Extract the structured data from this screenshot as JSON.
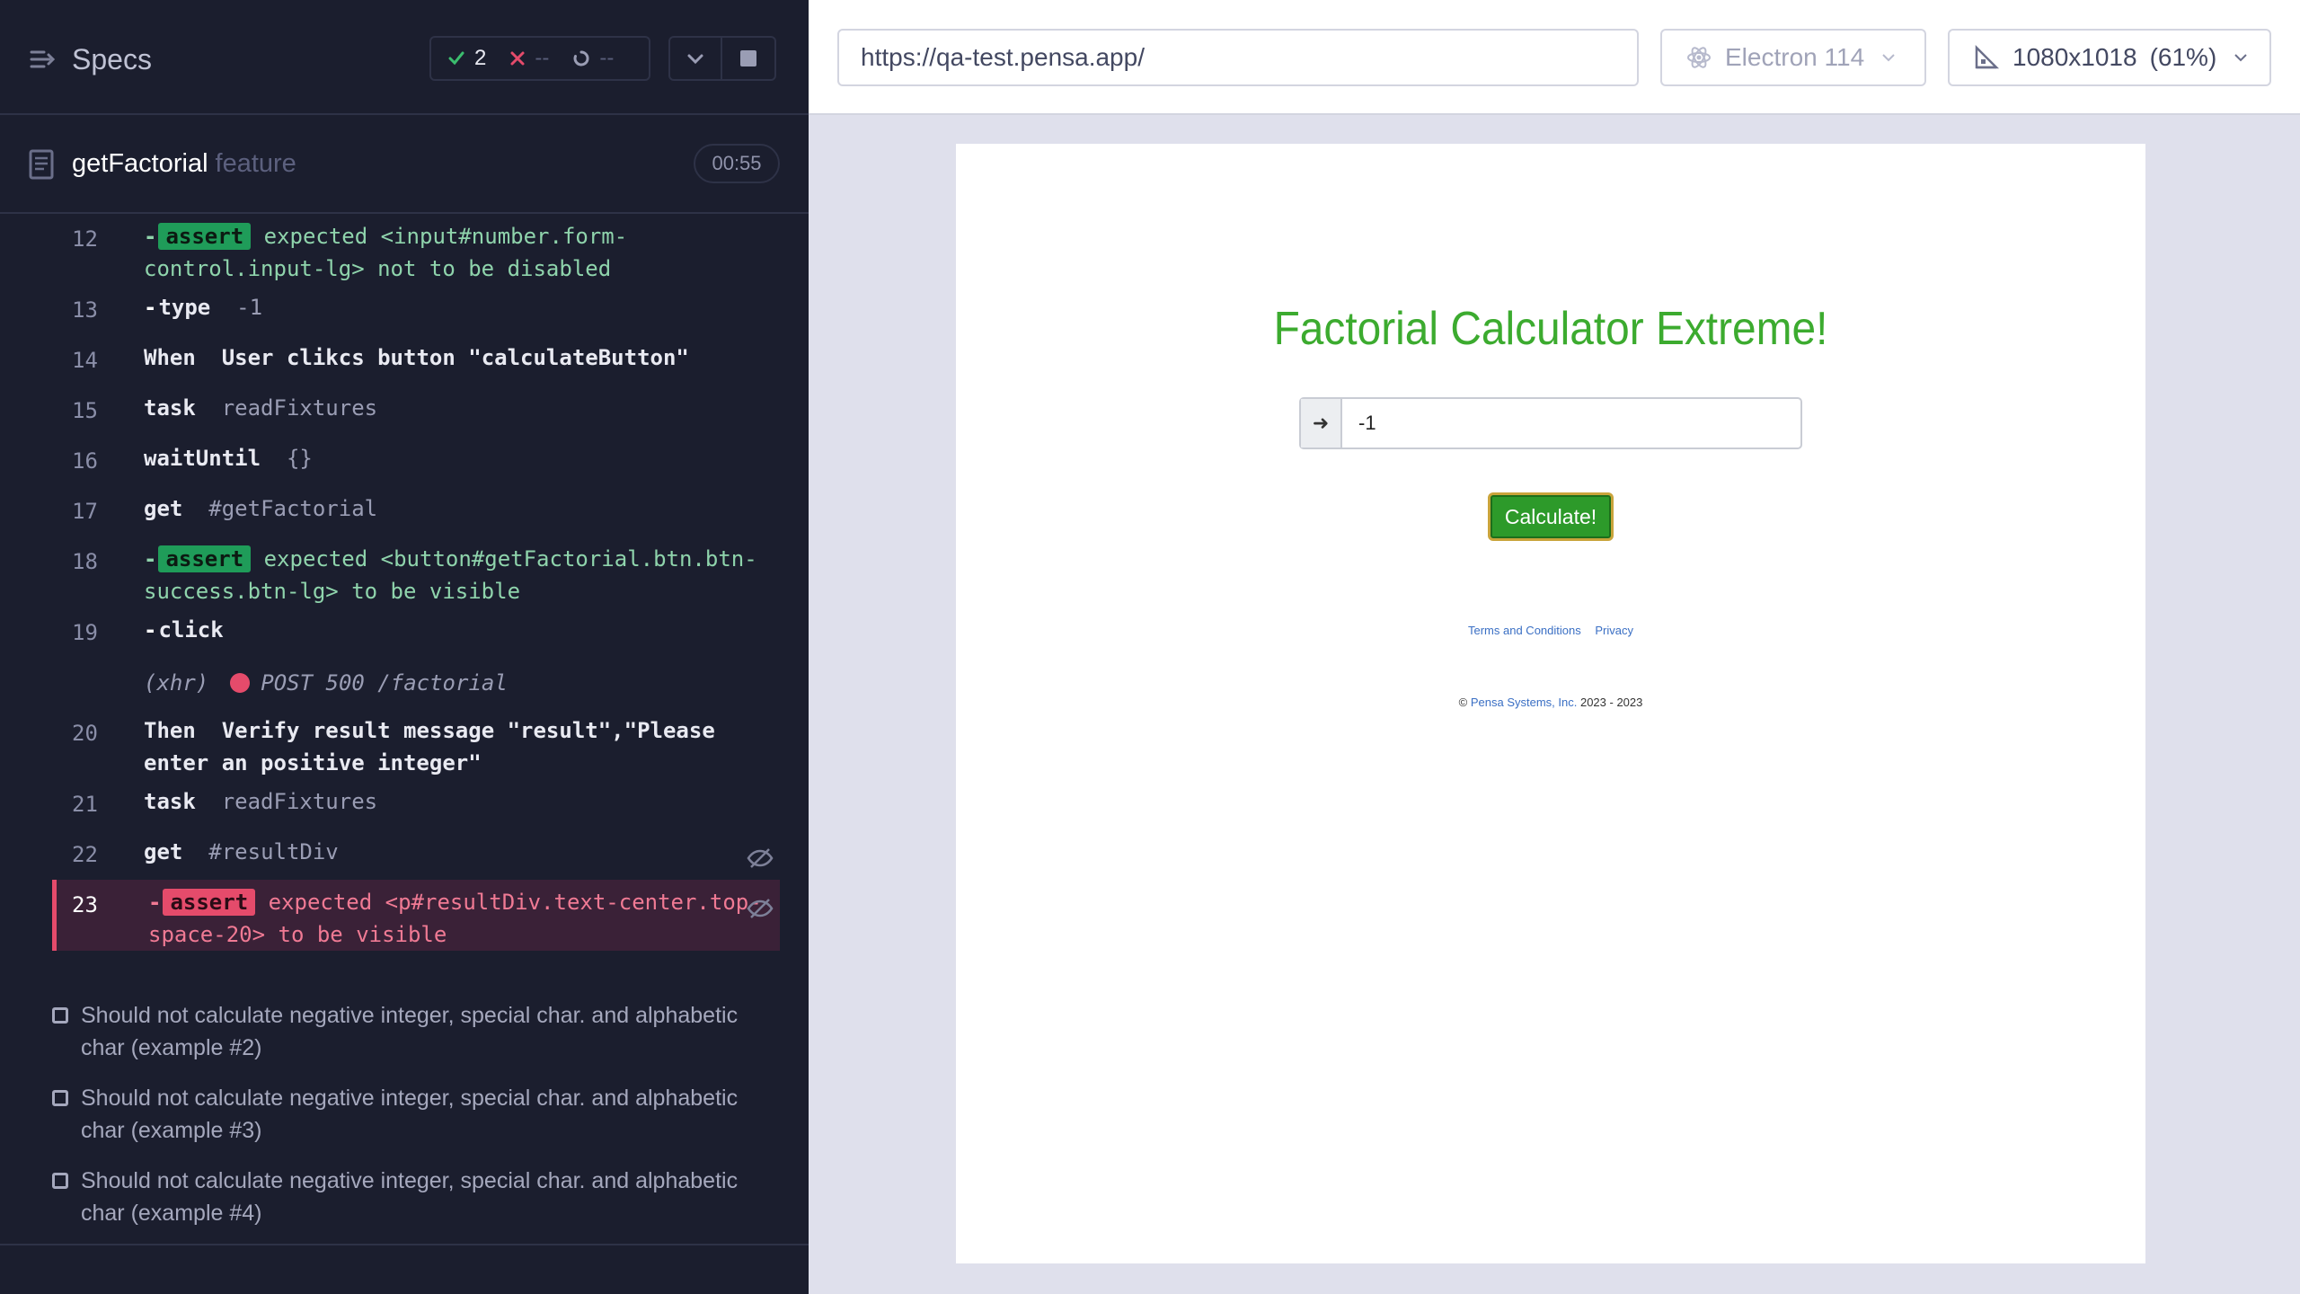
{
  "runner": {
    "specs_label": "Specs",
    "stats": {
      "passed": "2",
      "failed": "--",
      "pending": "--"
    },
    "spec": {
      "name": "getFactorial",
      "extension": "feature",
      "duration": "00:55"
    },
    "commands": [
      {
        "line": "12",
        "type": "assert",
        "badge": "assert",
        "text": "expected <input#number.form-control.input-lg> not to be disabled"
      },
      {
        "line": "13",
        "cmd": "type",
        "arg": "-1"
      },
      {
        "line": "14",
        "cmd": "When",
        "arg": "User clikcs button \"calculateButton\""
      },
      {
        "line": "15",
        "cmd": "task",
        "arg": "readFixtures"
      },
      {
        "line": "16",
        "cmd": "waitUntil",
        "arg": "{}"
      },
      {
        "line": "17",
        "cmd": "get",
        "arg": "#getFactorial"
      },
      {
        "line": "18",
        "type": "assert",
        "badge": "assert",
        "text": "expected <button#getFactorial.btn.btn-success.btn-lg> to be visible"
      },
      {
        "line": "19",
        "cmd": "click",
        "arg": ""
      },
      {
        "line": "",
        "xhr": "(xhr)",
        "xhr_text": "POST 500 /factorial"
      },
      {
        "line": "20",
        "cmd": "Then",
        "arg": "Verify result message \"result\",\"Please enter an positive integer\""
      },
      {
        "line": "21",
        "cmd": "task",
        "arg": "readFixtures"
      },
      {
        "line": "22",
        "cmd": "get",
        "arg": "#resultDiv"
      },
      {
        "line": "23",
        "type": "assert-fail",
        "badge": "assert",
        "text": "expected <p#resultDiv.text-center.top-space-20> to be visible"
      }
    ],
    "tests": [
      "Should not calculate negative integer, special char. and alphabetic char (example #2)",
      "Should not calculate negative integer, special char. and alphabetic char (example #3)",
      "Should not calculate negative integer, special char. and alphabetic char (example #4)"
    ]
  },
  "browser": {
    "url": "https://qa-test.pensa.app/",
    "browser_name": "Electron 114",
    "viewport": "1080x1018",
    "zoom": "(61%)"
  },
  "app": {
    "title": "Factorial Calculator Extreme!",
    "input_value": "-1",
    "button_label": "Calculate!",
    "terms_link": "Terms and Conditions",
    "privacy_link": "Privacy",
    "copyright_prefix": "©",
    "company_link": "Pensa Systems, Inc.",
    "copyright_years": "2023 - 2023"
  },
  "colors": {
    "pass": "#1f9c59",
    "fail": "#e54b6b",
    "app_title": "#3cab2f",
    "button": "#2d9a2a"
  }
}
